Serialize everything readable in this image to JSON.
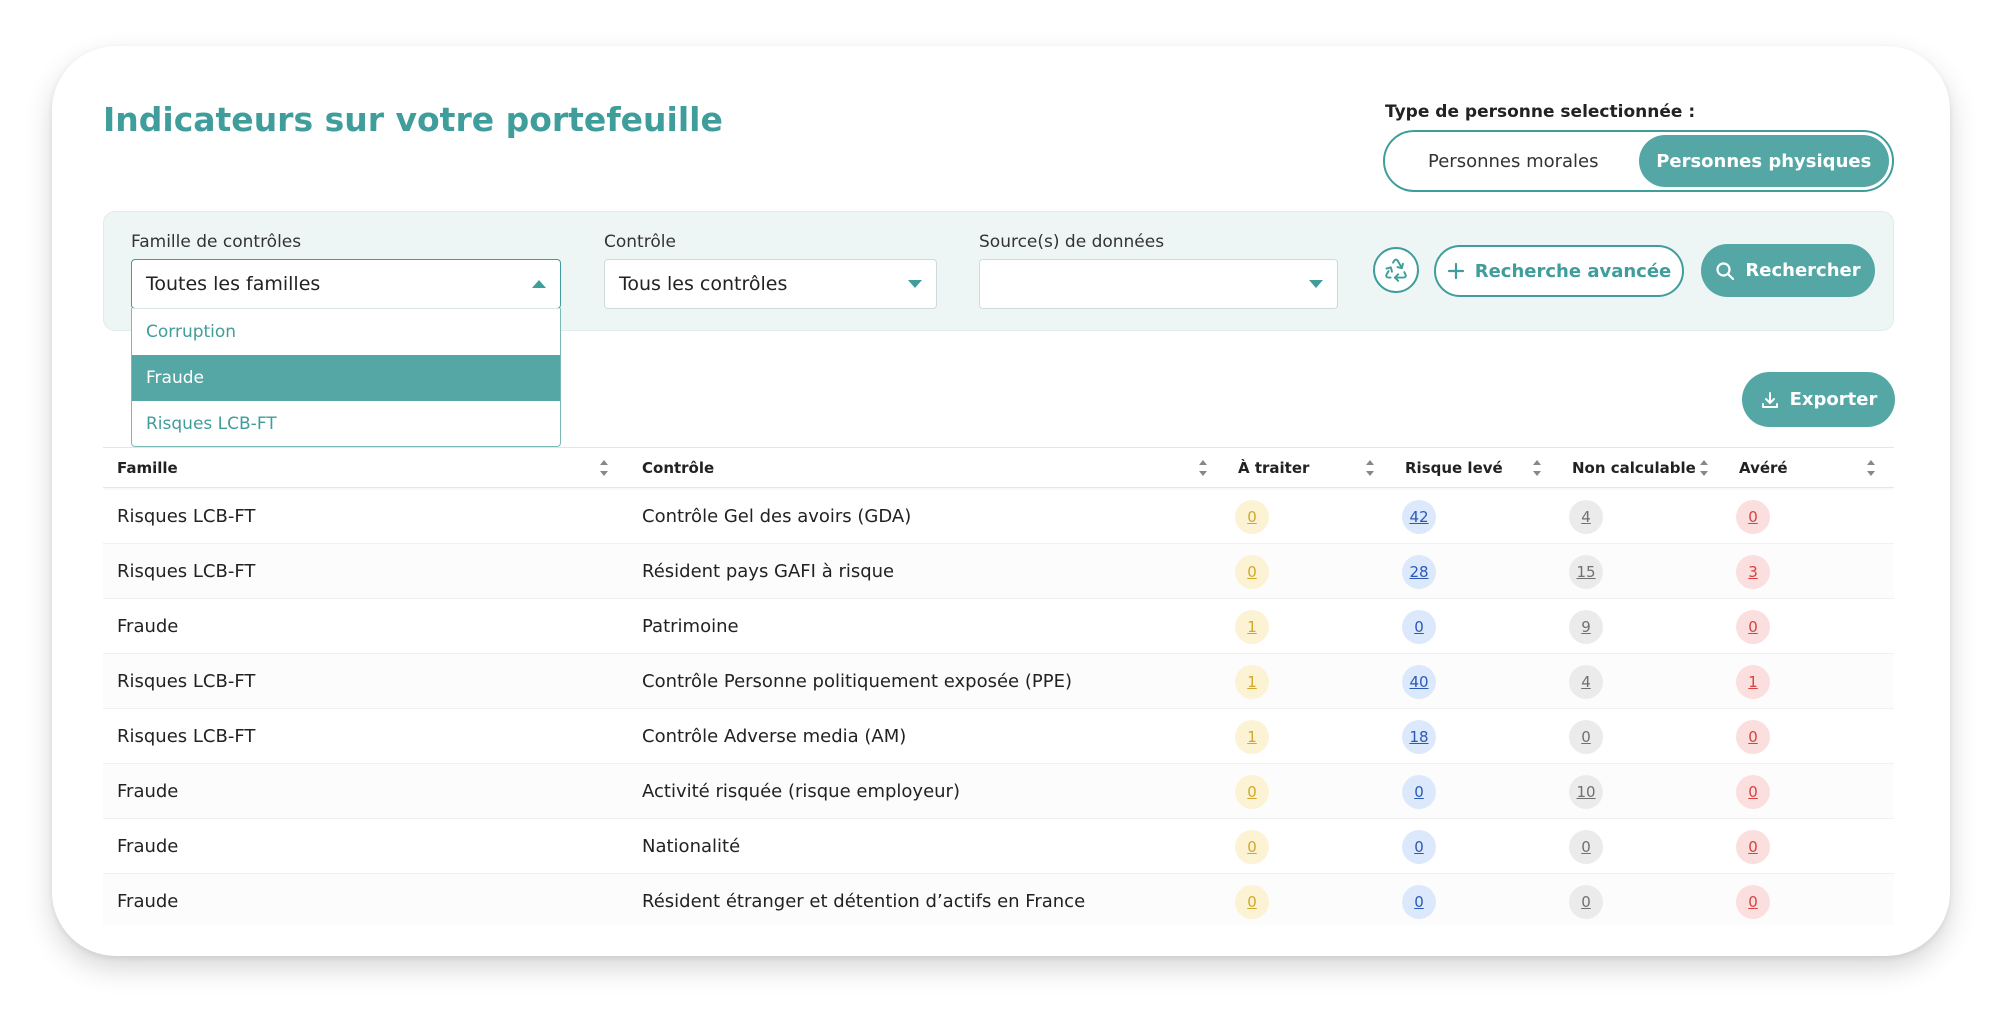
{
  "page": {
    "title": "Indicateurs sur votre portefeuille",
    "person_type_label": "Type de personne selectionnée :",
    "person_types": [
      {
        "label": "Personnes morales",
        "active": false
      },
      {
        "label": "Personnes physiques",
        "active": true
      }
    ]
  },
  "filters": {
    "family": {
      "label": "Famille de contrôles",
      "value": "Toutes les familles",
      "open": true,
      "options": [
        {
          "label": "Corruption",
          "selected": false
        },
        {
          "label": "Fraude",
          "selected": true
        },
        {
          "label": "Risques LCB-FT",
          "selected": false
        }
      ]
    },
    "control": {
      "label": "Contrôle",
      "value": "Tous les contrôles"
    },
    "source": {
      "label": "Source(s) de données",
      "value": ""
    },
    "reset_icon": "recycle-icon",
    "advanced_label": "Recherche avancée",
    "search_label": "Rechercher"
  },
  "export_label": "Exporter",
  "table": {
    "headers": [
      "Famille",
      "Contrôle",
      "À traiter",
      "Risque levé",
      "Non calculable",
      "Avéré"
    ],
    "rows": [
      {
        "famille": "Risques LCB-FT",
        "controle": "Contrôle Gel des avoirs (GDA)",
        "a_traiter": "0",
        "risque_leve": "42",
        "non_calculable": "4",
        "avere": "0"
      },
      {
        "famille": "Risques LCB-FT",
        "controle": "Résident pays GAFI à risque",
        "a_traiter": "0",
        "risque_leve": "28",
        "non_calculable": "15",
        "avere": "3"
      },
      {
        "famille": "Fraude",
        "controle": "Patrimoine",
        "a_traiter": "1",
        "risque_leve": "0",
        "non_calculable": "9",
        "avere": "0"
      },
      {
        "famille": "Risques LCB-FT",
        "controle": "Contrôle Personne politiquement exposée (PPE)",
        "a_traiter": "1",
        "risque_leve": "40",
        "non_calculable": "4",
        "avere": "1"
      },
      {
        "famille": "Risques LCB-FT",
        "controle": "Contrôle Adverse media (AM)",
        "a_traiter": "1",
        "risque_leve": "18",
        "non_calculable": "0",
        "avere": "0"
      },
      {
        "famille": "Fraude",
        "controle": "Activité risquée (risque employeur)",
        "a_traiter": "0",
        "risque_leve": "0",
        "non_calculable": "10",
        "avere": "0"
      },
      {
        "famille": "Fraude",
        "controle": "Nationalité",
        "a_traiter": "0",
        "risque_leve": "0",
        "non_calculable": "0",
        "avere": "0"
      },
      {
        "famille": "Fraude",
        "controle": "Résident étranger et détention d’actifs en France",
        "a_traiter": "0",
        "risque_leve": "0",
        "non_calculable": "0",
        "avere": "0"
      }
    ]
  },
  "colors": {
    "brand": "#3f9d9b",
    "brand_fill": "#55a7a5",
    "badge_yellow": "#d2a82c",
    "badge_blue": "#2b59b8",
    "badge_gray": "#707070",
    "badge_red": "#d64242"
  }
}
